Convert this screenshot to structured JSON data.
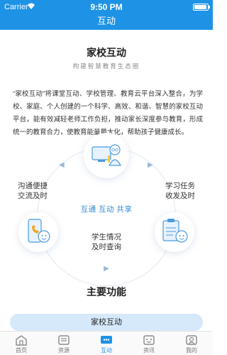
{
  "status_bar": {
    "carrier": "Carrier",
    "time": "9:50 PM"
  },
  "nav": {
    "title": "互动"
  },
  "section1": {
    "title": "家校互动",
    "subtitle": "构建智慧教育生态圈",
    "intro": "“家校互动”将课堂互动、学校管理、教育云平台深入整合，为学校、家庭、个人创建的一个科学、高效、和谐、智慧的家校互动平台，能有效减轻老师工作负担，推动家长深度参与教育，形成统一的教育合力，使教育能量最大化，帮助孩子健康成长。"
  },
  "diagram": {
    "center": "互通 互动 共享",
    "left": "沟通便捷\n交流及时",
    "right": "学习任务\n收发及时",
    "bottom": "学生情况\n及时查询"
  },
  "section2": {
    "title": "主要功能",
    "feature": "家校互动"
  },
  "tabs": [
    {
      "label": "首页",
      "icon": "home-icon",
      "active": false
    },
    {
      "label": "资源",
      "icon": "resource-icon",
      "active": false
    },
    {
      "label": "互动",
      "icon": "interact-icon",
      "active": true
    },
    {
      "label": "资讯",
      "icon": "news-icon",
      "active": false
    },
    {
      "label": "我的",
      "icon": "profile-icon",
      "active": false
    }
  ],
  "colors": {
    "primary": "#1e93e6",
    "light_accent": "#d6e9fb"
  }
}
